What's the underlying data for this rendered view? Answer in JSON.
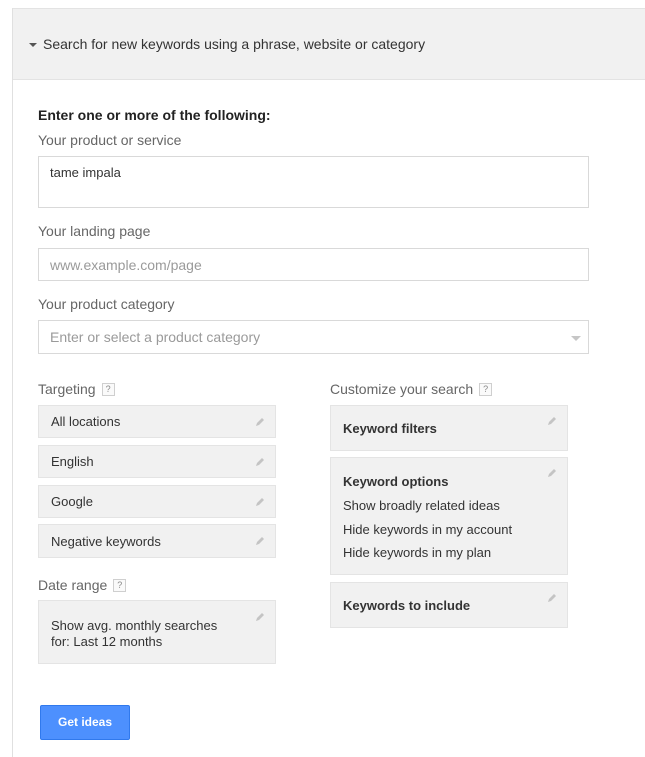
{
  "header": {
    "title": "Search for new keywords using a phrase, website or category"
  },
  "form": {
    "intro": "Enter one or more of the following:",
    "product": {
      "label": "Your product or service",
      "value": "tame impala"
    },
    "landing": {
      "label": "Your landing page",
      "placeholder": "www.example.com/page"
    },
    "category": {
      "label": "Your product category",
      "placeholder": "Enter or select a product category"
    }
  },
  "targeting": {
    "label": "Targeting",
    "help": "?",
    "items": [
      "All locations",
      "English",
      "Google",
      "Negative keywords"
    ]
  },
  "date_range": {
    "label": "Date range",
    "help": "?",
    "line1": "Show avg. monthly searches",
    "line2": "for: Last 12 months"
  },
  "customize": {
    "label": "Customize your search",
    "help": "?",
    "filters_title": "Keyword filters",
    "options_title": "Keyword options",
    "options_lines": [
      "Show broadly related ideas",
      "Hide keywords in my account",
      "Hide keywords in my plan"
    ],
    "include_title": "Keywords to include"
  },
  "actions": {
    "get_ideas": "Get ideas"
  },
  "colors": {
    "button": "#4d90fe",
    "panel_header": "#f1f1f1",
    "setting_box": "#f1f1f1"
  }
}
